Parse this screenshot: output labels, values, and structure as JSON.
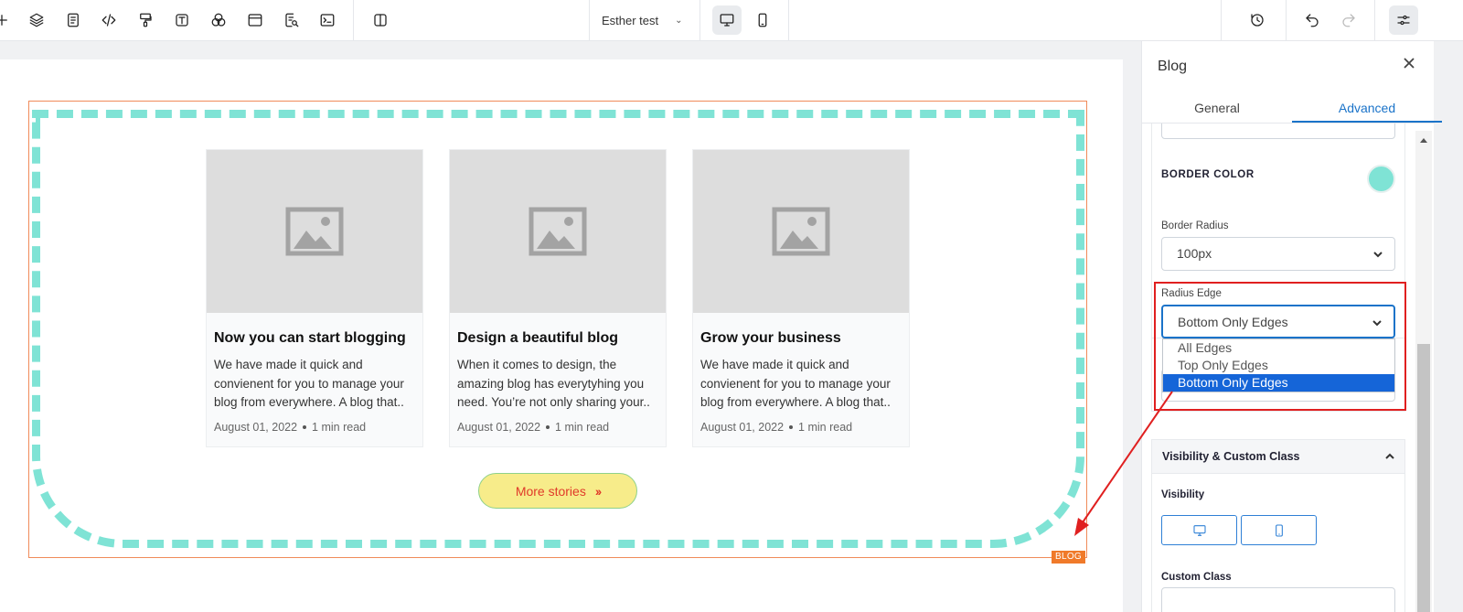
{
  "toolbar": {
    "page_name": "Esther test",
    "icons": [
      "plus-icon",
      "layers-icon",
      "pages-icon",
      "code-icon",
      "paint-roller-icon",
      "text-icon",
      "color-mix-icon",
      "layout-icon",
      "seo-icon",
      "terminal-icon",
      "split-view-icon",
      "history-icon",
      "undo-icon",
      "redo-icon",
      "settings-sliders-icon"
    ],
    "devices": [
      "desktop-icon",
      "mobile-icon"
    ],
    "active_device": "desktop"
  },
  "canvas": {
    "badge": "BLOG",
    "cards": [
      {
        "title": "Now you can start blogging",
        "desc": "We have made it quick and convienent for you to manage your blog from everywhere. A blog that..",
        "date": "August 01, 2022",
        "read": "1 min read"
      },
      {
        "title": "Design a beautiful blog",
        "desc": "When it comes to design, the amazing blog has everytyhing you need. You’re not only sharing your..",
        "date": "August 01, 2022",
        "read": "1 min read"
      },
      {
        "title": "Grow your business",
        "desc": "We have made it quick and convienent for you to manage your blog from everywhere. A blog that..",
        "date": "August 01, 2022",
        "read": "1 min read"
      }
    ],
    "more_button": "More stories",
    "border_color": "#7fe3d5",
    "button_bg": "#f7ec8a",
    "button_text_color": "#e03a2a"
  },
  "panel": {
    "title": "Blog",
    "tabs": [
      "General",
      "Advanced"
    ],
    "active_tab": "Advanced",
    "border_color_label": "BORDER COLOR",
    "border_radius_label": "Border Radius",
    "border_radius_value": "100px",
    "radius_edge_label": "Radius Edge",
    "radius_edge_value": "Bottom Only Edges",
    "radius_edge_options": [
      "All Edges",
      "Top Only Edges",
      "Bottom Only Edges"
    ],
    "visibility_section": "Visibility & Custom Class",
    "visibility_label": "Visibility",
    "custom_class_label": "Custom Class",
    "accent": "#1a73c9"
  },
  "annotation_color": "#e02020"
}
